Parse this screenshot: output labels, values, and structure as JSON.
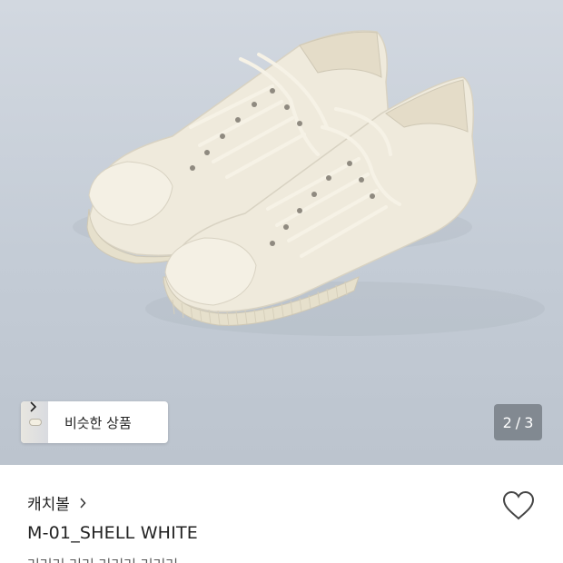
{
  "hero": {
    "image_alt": "cream canvas low-top sneakers",
    "similar_items_label": "비슷한 상품",
    "pager_current": "2",
    "pager_separator": "/",
    "pager_total": "3"
  },
  "product": {
    "brand": "캐치볼",
    "name": "M-01_SHELL WHITE",
    "partial_line": "러러러 러러 러러러 러러러"
  },
  "colors": {
    "hero_background": "#c4ccd6",
    "shoe": "#efeadc",
    "text_primary": "#222222"
  },
  "icons": {
    "similar_chevron": "chevron-right-icon",
    "brand_chevron": "chevron-right-icon",
    "favorite": "heart-outline-icon"
  }
}
